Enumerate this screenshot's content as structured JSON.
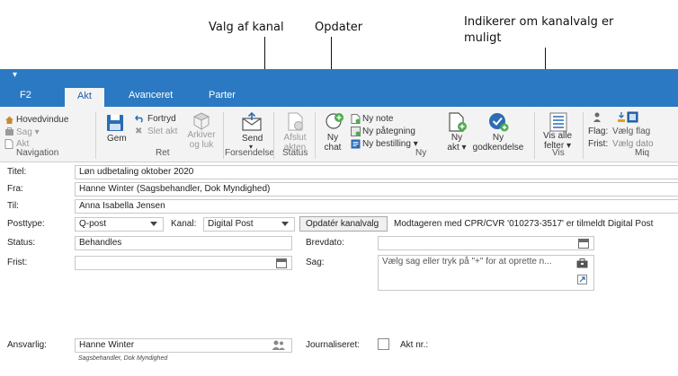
{
  "annotations": {
    "channel_choice": "Valg af kanal",
    "update": "Opdater",
    "indicator_line1": "Indikerer om kanalvalg er",
    "indicator_line2": "muligt"
  },
  "tabs": [
    {
      "label": "F2"
    },
    {
      "label": "Akt"
    },
    {
      "label": "Avanceret"
    },
    {
      "label": "Parter"
    }
  ],
  "ribbon": {
    "navigation": {
      "main_window": "Hovedvindue",
      "case": "Sag",
      "act": "Akt",
      "label": "Navigation"
    },
    "ret": {
      "save": "Gem",
      "undo": "Fortryd",
      "delete_act": "Slet akt",
      "archive_line1": "Arkiver",
      "archive_line2": "og luk",
      "label": "Ret"
    },
    "send": {
      "send": "Send",
      "label": "Forsendelse"
    },
    "status": {
      "close_line1": "Afslut",
      "close_line2": "akten",
      "label": "Status"
    },
    "new": {
      "new_chat_line1": "Ny",
      "new_chat_line2": "chat",
      "new_note": "Ny note",
      "new_endorsement": "Ny påtegning",
      "new_order": "Ny bestilling",
      "new_act_line1": "Ny",
      "new_act_line2": "akt",
      "new_approval_line1": "Ny",
      "new_approval_line2": "godkendelse",
      "label": "Ny"
    },
    "view": {
      "show_all_line1": "Vis alle",
      "show_all_line2": "felter",
      "label": "Vis"
    },
    "misc": {
      "flag": "Flag:",
      "choose_flag": "Vælg flag",
      "deadline": "Frist:",
      "choose_date": "Vælg dato",
      "label": "Miq"
    }
  },
  "form": {
    "title_label": "Titel:",
    "title_value": "Løn udbetaling oktober 2020",
    "from_label": "Fra:",
    "from_value": "Hanne Winter (Sagsbehandler, Dok Myndighed)",
    "to_label": "Til:",
    "to_value": "Anna Isabella Jensen",
    "posttype_label": "Posttype:",
    "posttype_value": "Q-post",
    "channel_label": "Kanal:",
    "channel_value": "Digital Post",
    "update_channel_button": "Opdatér kanalvalg",
    "channel_status": "Modtageren med CPR/CVR '010273-3517' er tilmeldt Digital Post",
    "status_label": "Status:",
    "status_value": "Behandles",
    "letter_date_label": "Brevdato:",
    "letter_date_value": "",
    "deadline_label": "Frist:",
    "deadline_value": "",
    "case_label": "Sag:",
    "case_placeholder": "Vælg sag eller tryk på \"+\" for at oprette n...",
    "responsible_label": "Ansvarlig:",
    "responsible_value": "Hanne Winter",
    "responsible_sub": "Sagsbehandler, Dok Myndighed",
    "journalized_label": "Journaliseret:",
    "act_no_label": "Akt nr.:"
  }
}
